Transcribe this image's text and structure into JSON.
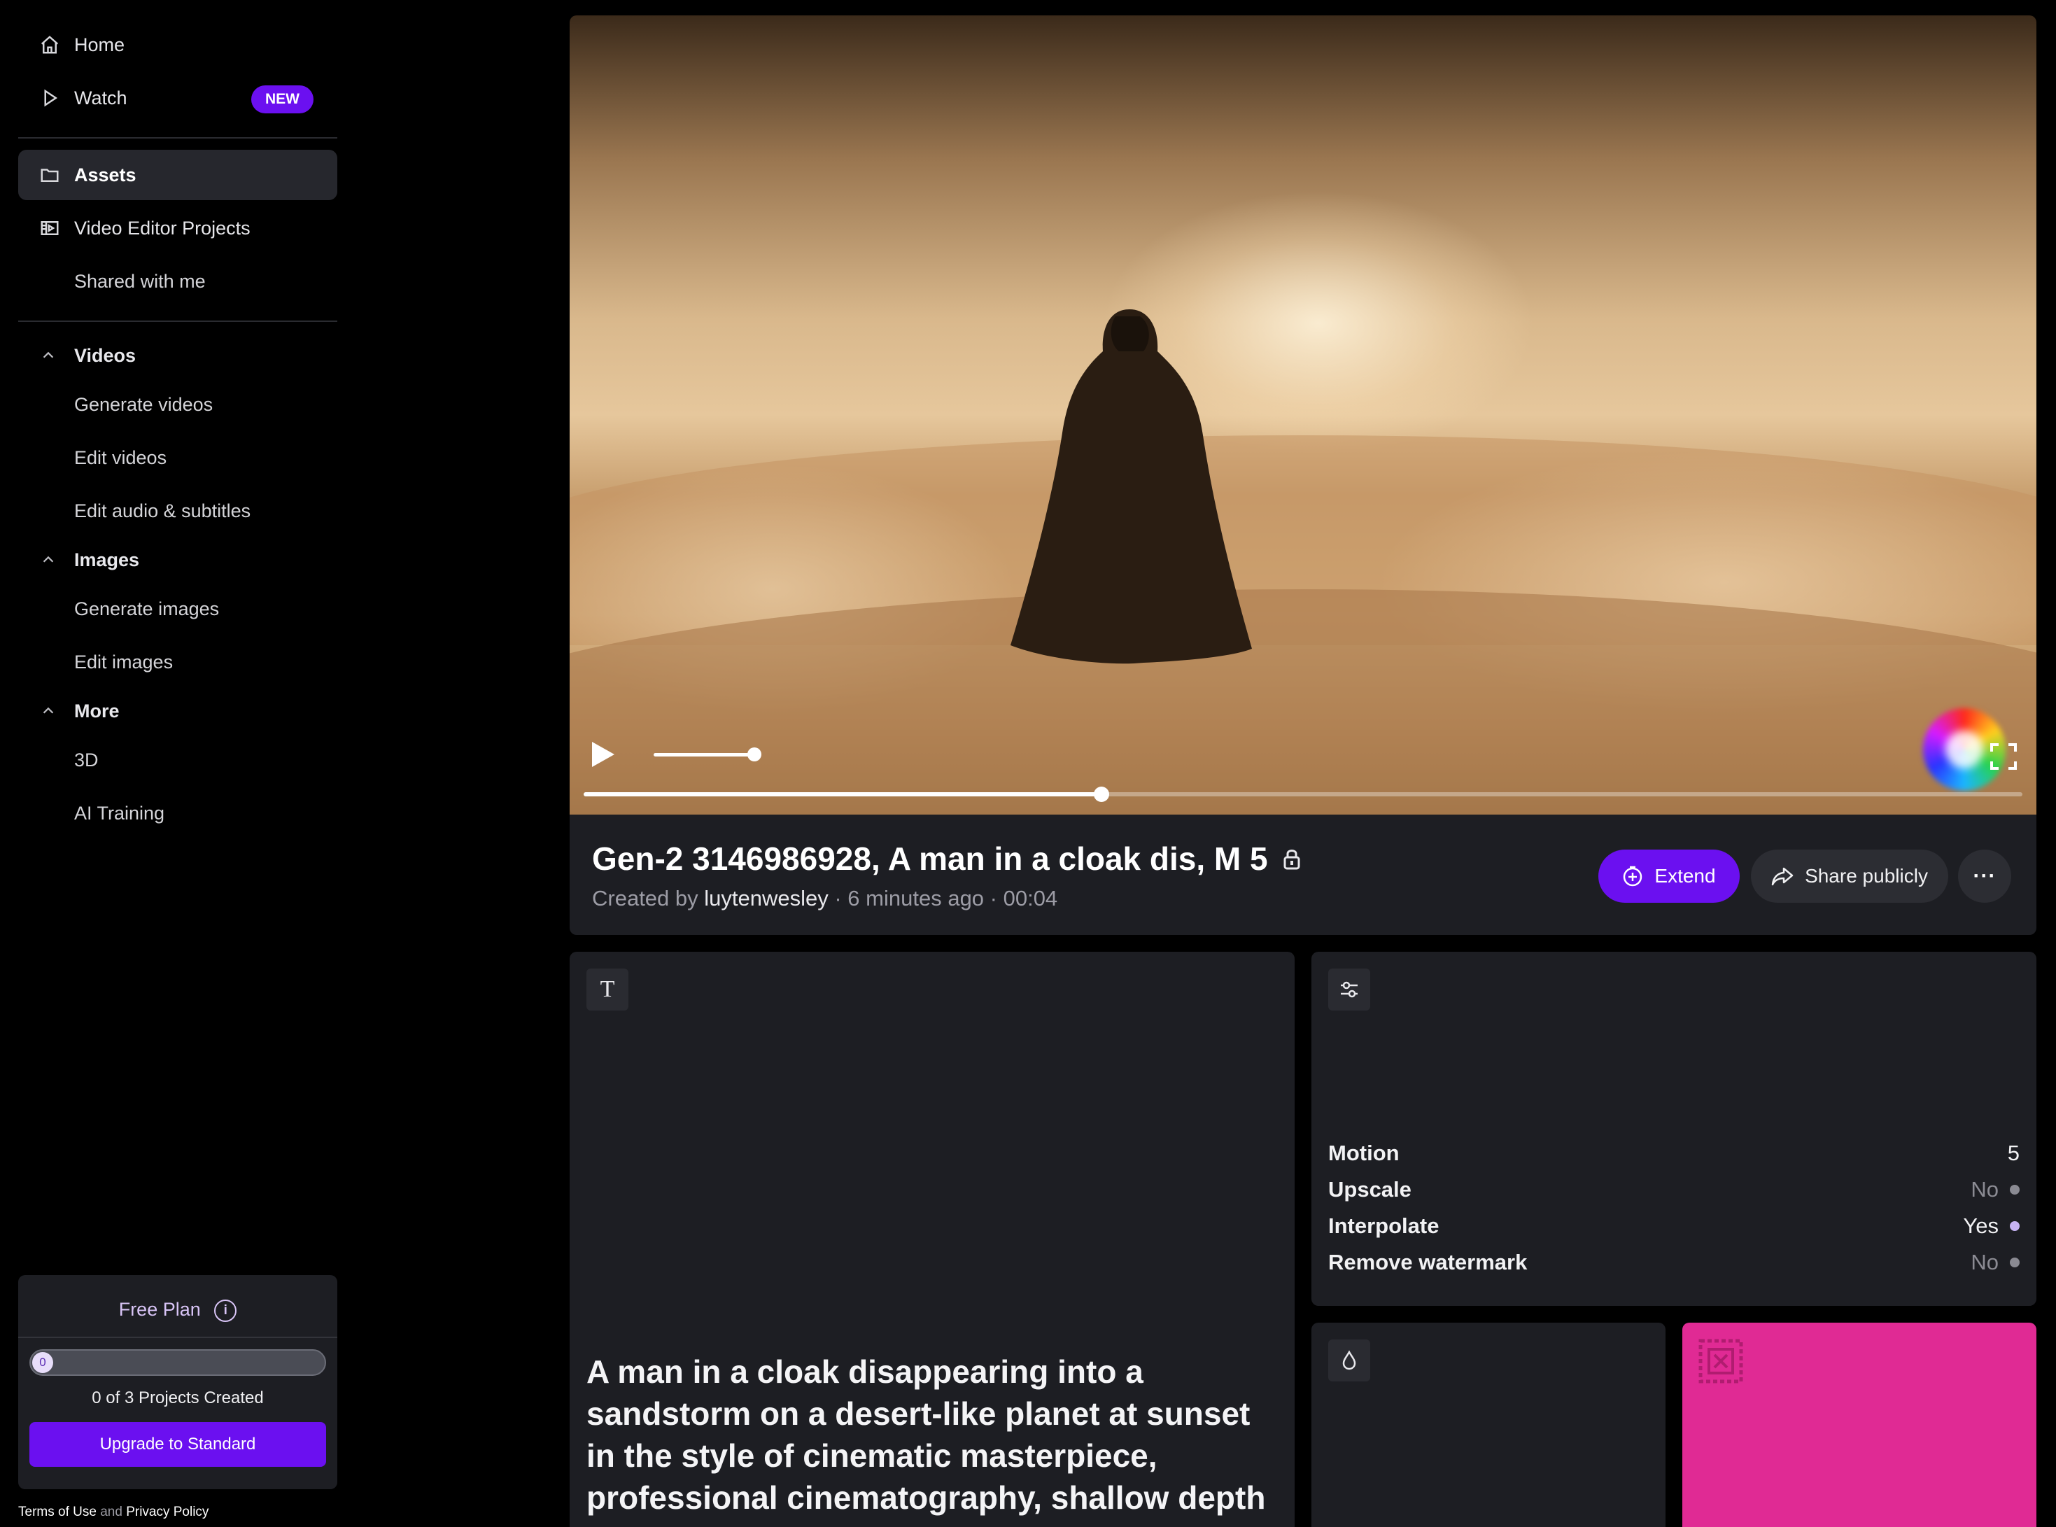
{
  "sidebar": {
    "home": "Home",
    "watch": "Watch",
    "watch_badge": "NEW",
    "assets": "Assets",
    "video_editor_projects": "Video Editor Projects",
    "shared_with_me": "Shared with me",
    "sections": {
      "videos": "Videos",
      "images": "Images",
      "more": "More"
    },
    "videos_items": [
      "Generate videos",
      "Edit videos",
      "Edit audio & subtitles"
    ],
    "images_items": [
      "Generate images",
      "Edit images"
    ],
    "more_items": [
      "3D",
      "AI Training"
    ],
    "plan": {
      "title": "Free Plan",
      "info_glyph": "i",
      "progress_value": "0",
      "progress_fraction": 0,
      "count_text": "0 of 3 Projects Created",
      "upgrade_label": "Upgrade to Standard"
    },
    "legal": {
      "terms": "Terms of Use",
      "and": "and",
      "privacy": "Privacy Policy"
    }
  },
  "player": {
    "progress_fraction": 0.36,
    "volume_fraction": 0.9
  },
  "asset": {
    "title": "Gen-2 3146986928, A man in a cloak dis, M 5",
    "meta_prefix": "Created by",
    "creator": "luytenwesley",
    "meta_suffix": "· 6 minutes ago · 00:04",
    "extend_label": "Extend",
    "share_label": "Share publicly",
    "more_label": "···"
  },
  "prompt": {
    "icon_glyph": "T",
    "text": "A man in a cloak disappearing into a sandstorm on a desert-like planet at sunset in the style of cinematic masterpiece, professional cinematography, shallow depth"
  },
  "settings": {
    "rows": [
      {
        "label": "Motion",
        "value": "5"
      },
      {
        "label": "Upscale",
        "value": "No"
      },
      {
        "label": "Interpolate",
        "value": "Yes"
      },
      {
        "label": "Remove watermark",
        "value": "No"
      }
    ]
  },
  "colors": {
    "accent": "#6b10f0",
    "panel": "#1d1e23",
    "seed_swatch": "#e02a94"
  }
}
